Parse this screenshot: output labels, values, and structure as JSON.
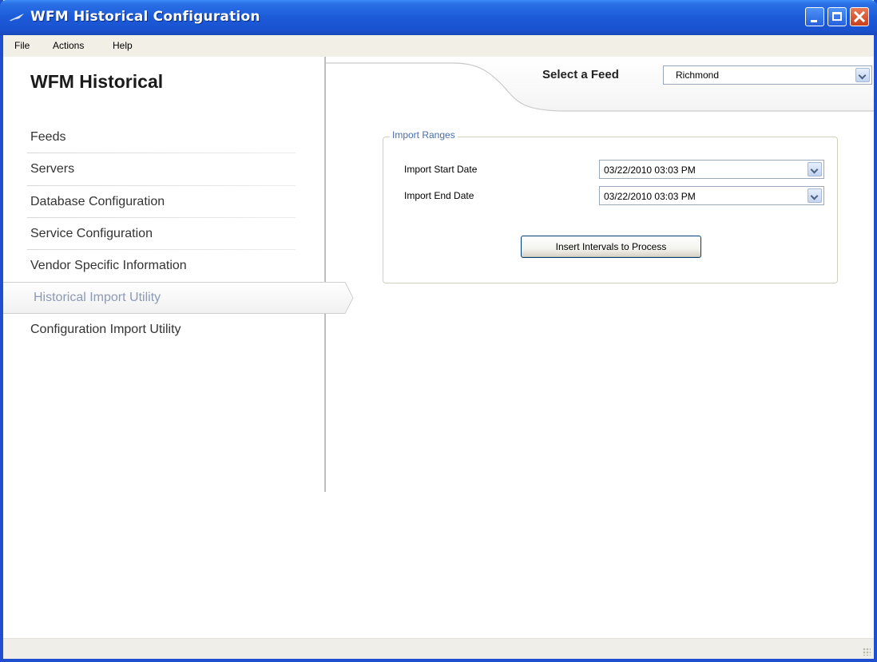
{
  "window": {
    "title": "WFM Historical Configuration",
    "title_icon": "app-feather-icon",
    "accent": "#1f4fd0"
  },
  "menu": {
    "items": [
      "File",
      "Actions",
      "Help"
    ]
  },
  "sidebar": {
    "title": "WFM Historical",
    "items": [
      {
        "label": "Feeds"
      },
      {
        "label": "Servers"
      },
      {
        "label": "Database Configuration"
      },
      {
        "label": "Service Configuration"
      },
      {
        "label": "Vendor Specific Information"
      },
      {
        "label": "Historical Import Utility",
        "active": true
      },
      {
        "label": "Configuration Import Utility"
      }
    ],
    "active_color": "#8c9ab5"
  },
  "feed": {
    "label": "Select a Feed",
    "selected": "Richmond"
  },
  "import_ranges": {
    "legend": "Import Ranges",
    "start_label": "Import Start Date",
    "start_value": "03/22/2010 03:03 PM",
    "end_label": "Import End Date",
    "end_value": "03/22/2010 03:03 PM",
    "button_label": "Insert Intervals to Process"
  }
}
